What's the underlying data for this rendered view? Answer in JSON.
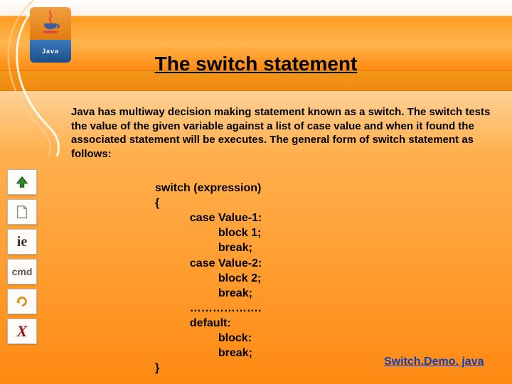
{
  "header": {
    "title": "The switch statement",
    "logo_text": "Java"
  },
  "body": {
    "paragraph": "Java has multiway decision making statement known as a switch. The switch tests the value of the given variable against a list of case value and when it found the associated statement will be executes. The general form of switch statement as follows:"
  },
  "code": {
    "line1": "switch (expression)",
    "line2": "{",
    "line3": "           case Value-1:",
    "line4": "                    block 1;",
    "line5": "                    break;",
    "line6": "           case Value-2:",
    "line7": "                    block 2;",
    "line8": "                    break;",
    "line9": "           ………………. ",
    "line10": "           default:",
    "line11": "                    block:",
    "line12": "                    break;",
    "line13": "}"
  },
  "link": {
    "label": "Switch.Demo. java"
  },
  "sidebar": {
    "ie_label": "ie",
    "cmd_label": "cmd",
    "x_label": "X"
  },
  "colors": {
    "orange_light": "#ffb04e",
    "orange_dark": "#ff8a12",
    "link_blue": "#0b3fbf"
  }
}
